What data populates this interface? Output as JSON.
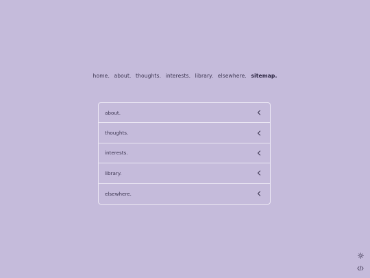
{
  "nav": {
    "items": [
      {
        "label": "home."
      },
      {
        "label": "about."
      },
      {
        "label": "thoughts."
      },
      {
        "label": "interests."
      },
      {
        "label": "library."
      },
      {
        "label": "elsewhere."
      },
      {
        "label": "sitemap.",
        "active": true
      }
    ]
  },
  "sitemap": {
    "rows": [
      {
        "label": "about.",
        "icon": "chevron-left-icon"
      },
      {
        "label": "thoughts.",
        "icon": "chevron-left-icon"
      },
      {
        "label": "interests.",
        "icon": "chevron-left-icon"
      },
      {
        "label": "library.",
        "icon": "chevron-left-icon"
      },
      {
        "label": "elsewhere.",
        "icon": "chevron-left-icon"
      }
    ]
  },
  "corner": {
    "theme_icon": "sun-icon",
    "source_icon": "code-icon"
  },
  "colors": {
    "background": "#c5bbdb",
    "text": "#3b3550",
    "border": "#ece8f4"
  }
}
